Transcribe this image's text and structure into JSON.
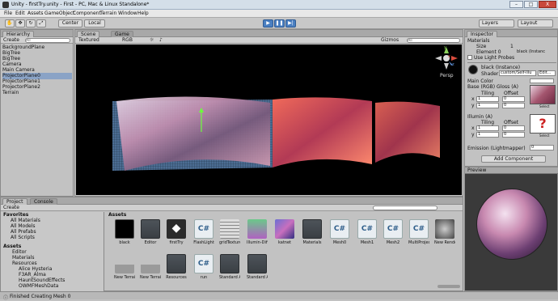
{
  "window": {
    "title": "Unity - firstTry.unity - First - PC, Mac & Linux Standalone*",
    "minimize": "–",
    "maximize": "□",
    "close": "X"
  },
  "menu": [
    "File",
    "Edit",
    "Assets",
    "GameObject",
    "Component",
    "Terrain",
    "Window",
    "Help"
  ],
  "toolbar": {
    "center": "Center",
    "local": "Local",
    "layers": "Layers",
    "layout": "Layout"
  },
  "hierarchy": {
    "tab": "Hierarchy",
    "create": "Create",
    "search_placeholder": "All",
    "items": [
      "BackgroundPlane",
      "BigTree",
      "BigTree",
      "Camera",
      "Main Camera",
      "ProjectorPlane0",
      "ProjectorPlane1",
      "ProjectorPlane2",
      "Terrain"
    ],
    "selected_index": 5
  },
  "scene": {
    "tab_scene": "Scene",
    "tab_game": "Game",
    "mode": "Textured",
    "color": "RGB",
    "gizmos": "Gizmos",
    "search_placeholder": "All",
    "persp": "Persp",
    "axis_x": "x",
    "axis_y": "y",
    "axis_z": "z"
  },
  "inspector": {
    "tab": "Inspector",
    "materials_label": "Materials",
    "size_label": "Size",
    "size_value": "1",
    "element_label": "Element 0",
    "element_value": "black (Instanc",
    "probes_label": "Use Light Probes",
    "mat_name": "black (Instance)",
    "shader_label": "Shader",
    "shader_value": "custom/Self-Illu",
    "edit_label": "Edit...",
    "main_color": "Main Color",
    "base_label": "Base (RGB) Gloss (A)",
    "tiling1": "Tiling",
    "offset1": "Offset",
    "x1t": "1",
    "x1o": "0",
    "y1t": "1",
    "y1o": "0",
    "illum_label": "Illumin (A)",
    "tiling2": "Tiling",
    "offset2": "Offset",
    "x2t": "1",
    "x2o": "0",
    "y2t": "1",
    "y2o": "0",
    "select1": "Select",
    "select2": "Select",
    "emission_label": "Emission (Lightmapper)",
    "emission_value": "0",
    "add_component": "Add Component",
    "preview": "Preview",
    "x_lbl": "x",
    "y_lbl": "y"
  },
  "project": {
    "tab_project": "Project",
    "tab_console": "Console",
    "create": "Create",
    "favorites": "Favorites",
    "fav_items": [
      "All Materials",
      "All Models",
      "All Prefabs",
      "All Scripts"
    ],
    "assets_root": "Assets",
    "tree_items": [
      "Editor",
      "Materials",
      "Resources",
      "Alice Hysteria",
      "F3AR_Alma",
      "HauntSoundEffects",
      "OWMFMeshData"
    ],
    "assets_header": "Assets",
    "search_placeholder": "",
    "row1": [
      "black",
      "Editor",
      "firstTry",
      "FlashLight",
      "gridTexture",
      "Illumin-Diff...",
      "katnet",
      "Materials",
      "Mesh0",
      "Mesh1",
      "Mesh2",
      "MultiProjec...",
      "New Render..."
    ],
    "row2": [
      "New Terrain",
      "New Terrain...",
      "Resources",
      "run",
      "Standard A...",
      "Standard A..."
    ]
  },
  "status": {
    "text": "Finished Creating Mesh 0"
  },
  "colors": {
    "accent": "#4a7fc1",
    "selection": "#8aa3c6",
    "panel": "#c2c2c2"
  }
}
